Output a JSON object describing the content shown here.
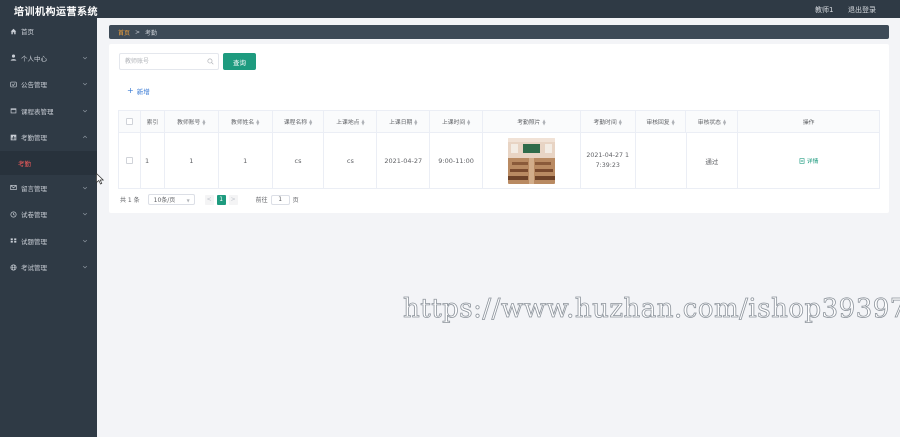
{
  "app": {
    "title": "培训机构运营系统",
    "user": "教师1",
    "logout": "退出登录"
  },
  "sidebar": {
    "items": [
      {
        "label": "首页",
        "icon": "home-icon",
        "expandable": false
      },
      {
        "label": "个人中心",
        "icon": "user-icon",
        "expandable": true
      },
      {
        "label": "公告管理",
        "icon": "notice-icon",
        "expandable": true
      },
      {
        "label": "课程表管理",
        "icon": "calendar-icon",
        "expandable": true
      },
      {
        "label": "考勤管理",
        "icon": "chart-icon",
        "expandable": true,
        "expanded": true,
        "children": [
          {
            "label": "考勤",
            "active": true
          }
        ]
      },
      {
        "label": "留言管理",
        "icon": "mail-icon",
        "expandable": true
      },
      {
        "label": "试卷管理",
        "icon": "clock-icon",
        "expandable": true
      },
      {
        "label": "试题管理",
        "icon": "grid-icon",
        "expandable": true
      },
      {
        "label": "考试管理",
        "icon": "globe-icon",
        "expandable": true
      }
    ]
  },
  "breadcrumb": {
    "home": "首页",
    "separator": ">",
    "current": "考勤"
  },
  "search": {
    "placeholder": "教师账号",
    "button": "查询"
  },
  "toolbar": {
    "add": "新增"
  },
  "table": {
    "columns": [
      "索引",
      "教师账号",
      "教师姓名",
      "课程名称",
      "上课地点",
      "上课日期",
      "上课时间",
      "考勤照片",
      "考勤时间",
      "审核回复",
      "审核状态",
      "操作"
    ],
    "rows": [
      {
        "index": "1",
        "teacher_account": "1",
        "teacher_name": "1",
        "course_name": "cs",
        "location": "cs",
        "date": "2021-04-27",
        "time": "9:00-11:00",
        "photo": "classroom-photo",
        "checkin_time_1": "2021-04-27 1",
        "checkin_time_2": "7:39:23",
        "review_reply": "",
        "review_status": "通过",
        "action": "详情"
      }
    ]
  },
  "pagination": {
    "total": "共 1 条",
    "page_size": "10条/页",
    "prev": "<",
    "current": "1",
    "next": ">",
    "goto_prefix": "前往",
    "goto_value": "1",
    "goto_suffix": "页"
  },
  "watermark": "https://www.huzhan.com/ishop39397",
  "colors": {
    "sidebar": "#2f3a45",
    "accent": "#1e9b7f",
    "active_menu": "#ef5b5b",
    "breadcrumb_home": "#f3a23b",
    "link": "#3a7bd5"
  }
}
